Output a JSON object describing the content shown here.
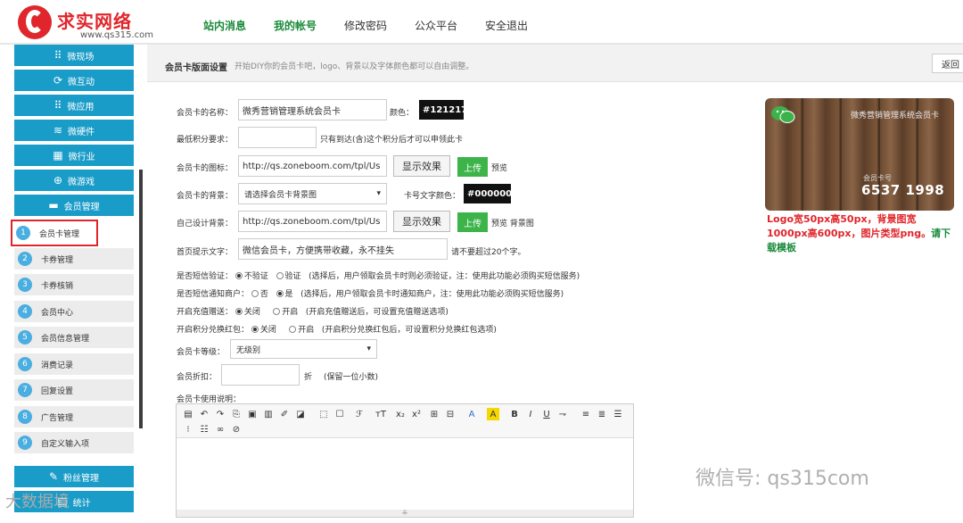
{
  "brand": {
    "title": "求实网络",
    "url": "www.qs315.com"
  },
  "topnav": [
    {
      "label": "站内消息",
      "green": true
    },
    {
      "label": "我的帐号",
      "green": true
    },
    {
      "label": "修改密码",
      "green": false
    },
    {
      "label": "公众平台",
      "green": false
    },
    {
      "label": "安全退出",
      "green": false
    }
  ],
  "sidebar": {
    "top_items": [
      {
        "label": "微现场",
        "icon": "grid-icon"
      },
      {
        "label": "微互动",
        "icon": "refresh-icon"
      },
      {
        "label": "微应用",
        "icon": "grid-icon"
      },
      {
        "label": "微硬件",
        "icon": "wifi-icon"
      },
      {
        "label": "微行业",
        "icon": "tiles-icon"
      },
      {
        "label": "微游戏",
        "icon": "gamepad-icon"
      },
      {
        "label": "会员管理",
        "icon": "card-icon"
      }
    ],
    "sub_items": [
      {
        "num": "1",
        "label": "会员卡管理",
        "active": true
      },
      {
        "num": "2",
        "label": "卡券管理"
      },
      {
        "num": "3",
        "label": "卡券核销"
      },
      {
        "num": "4",
        "label": "会员中心"
      },
      {
        "num": "5",
        "label": "会员信息管理"
      },
      {
        "num": "6",
        "label": "消费记录"
      },
      {
        "num": "7",
        "label": "回复设置"
      },
      {
        "num": "8",
        "label": "广告管理"
      },
      {
        "num": "9",
        "label": "自定义输入项"
      }
    ],
    "bottom_items": [
      {
        "label": "粉丝管理",
        "icon": "edit-icon"
      },
      {
        "label": "统计",
        "icon": "chart-icon"
      }
    ]
  },
  "main": {
    "title": "会员卡版面设置",
    "desc": "开始DIY你的会员卡吧，logo、背景以及字体颜色都可以自由调整。",
    "back": "返回"
  },
  "form": {
    "card_name_label": "会员卡的名称：",
    "card_name_value": "微秀营销管理系统会员卡",
    "color_label": "颜色：",
    "color_value": "#121217",
    "min_points_label": "最低积分要求：",
    "min_points_value": "",
    "min_points_hint": "只有到达(含)这个积分后才可以申领此卡",
    "icon_label": "会员卡的图标：",
    "icon_value": "http://qs.zoneboom.com/tpl/Us",
    "show_effect": "显示效果",
    "upload": "上传",
    "preview": "预览",
    "bg_label": "会员卡的背景：",
    "bg_select": "请选择会员卡背景图",
    "card_no_color_label": "卡号文字颜色：",
    "card_no_color_value": "#000000",
    "custom_bg_label": "自己设计背景：",
    "custom_bg_value": "http://qs.zoneboom.com/tpl/Us",
    "preview_bg": "预览 背景图",
    "prompt_label": "首页提示文字：",
    "prompt_value": "微信会员卡，方便携带收藏，永不挂失",
    "prompt_hint": "请不要超过20个字。",
    "sms_label": "是否短信验证：",
    "sms_opt1": "不验证",
    "sms_opt2": "验证",
    "sms_hint": "(选择后，用户领取会员卡时则必须验证，注：使用此功能必须购买短信服务)",
    "notify_label": "是否短信通知商户：",
    "notify_opt1": "否",
    "notify_opt2": "是",
    "notify_hint": "(选择后，用户领取会员卡时通知商户，注：使用此功能必须购买短信服务)",
    "recharge_label": "开启充值赠送：",
    "recharge_opt1": "关闭",
    "recharge_opt2": "开启",
    "recharge_hint": "(开启充值赠送后，可设置充值赠送选项)",
    "redpack_label": "开启积分兑换红包：",
    "redpack_opt1": "关闭",
    "redpack_opt2": "开启",
    "redpack_hint": "(开启积分兑换红包后，可设置积分兑换红包选项)",
    "level_label": "会员卡等级：",
    "level_select": "无级别",
    "discount_label": "会员折扣：",
    "discount_value": "",
    "discount_unit": "折",
    "discount_hint": "(保留一位小数)",
    "usage_label": "会员卡使用说明："
  },
  "card_preview": {
    "name": "微秀营销管理系统会员卡",
    "label": "会员卡号",
    "number": "6537 1998",
    "note1": "Logo宽50px高50px，背景图宽1000px高600px，图片类型png。",
    "note_link": "请下载模板"
  },
  "watermark": {
    "wechat": "微信号: qs315com",
    "bottom": "大数据境"
  }
}
